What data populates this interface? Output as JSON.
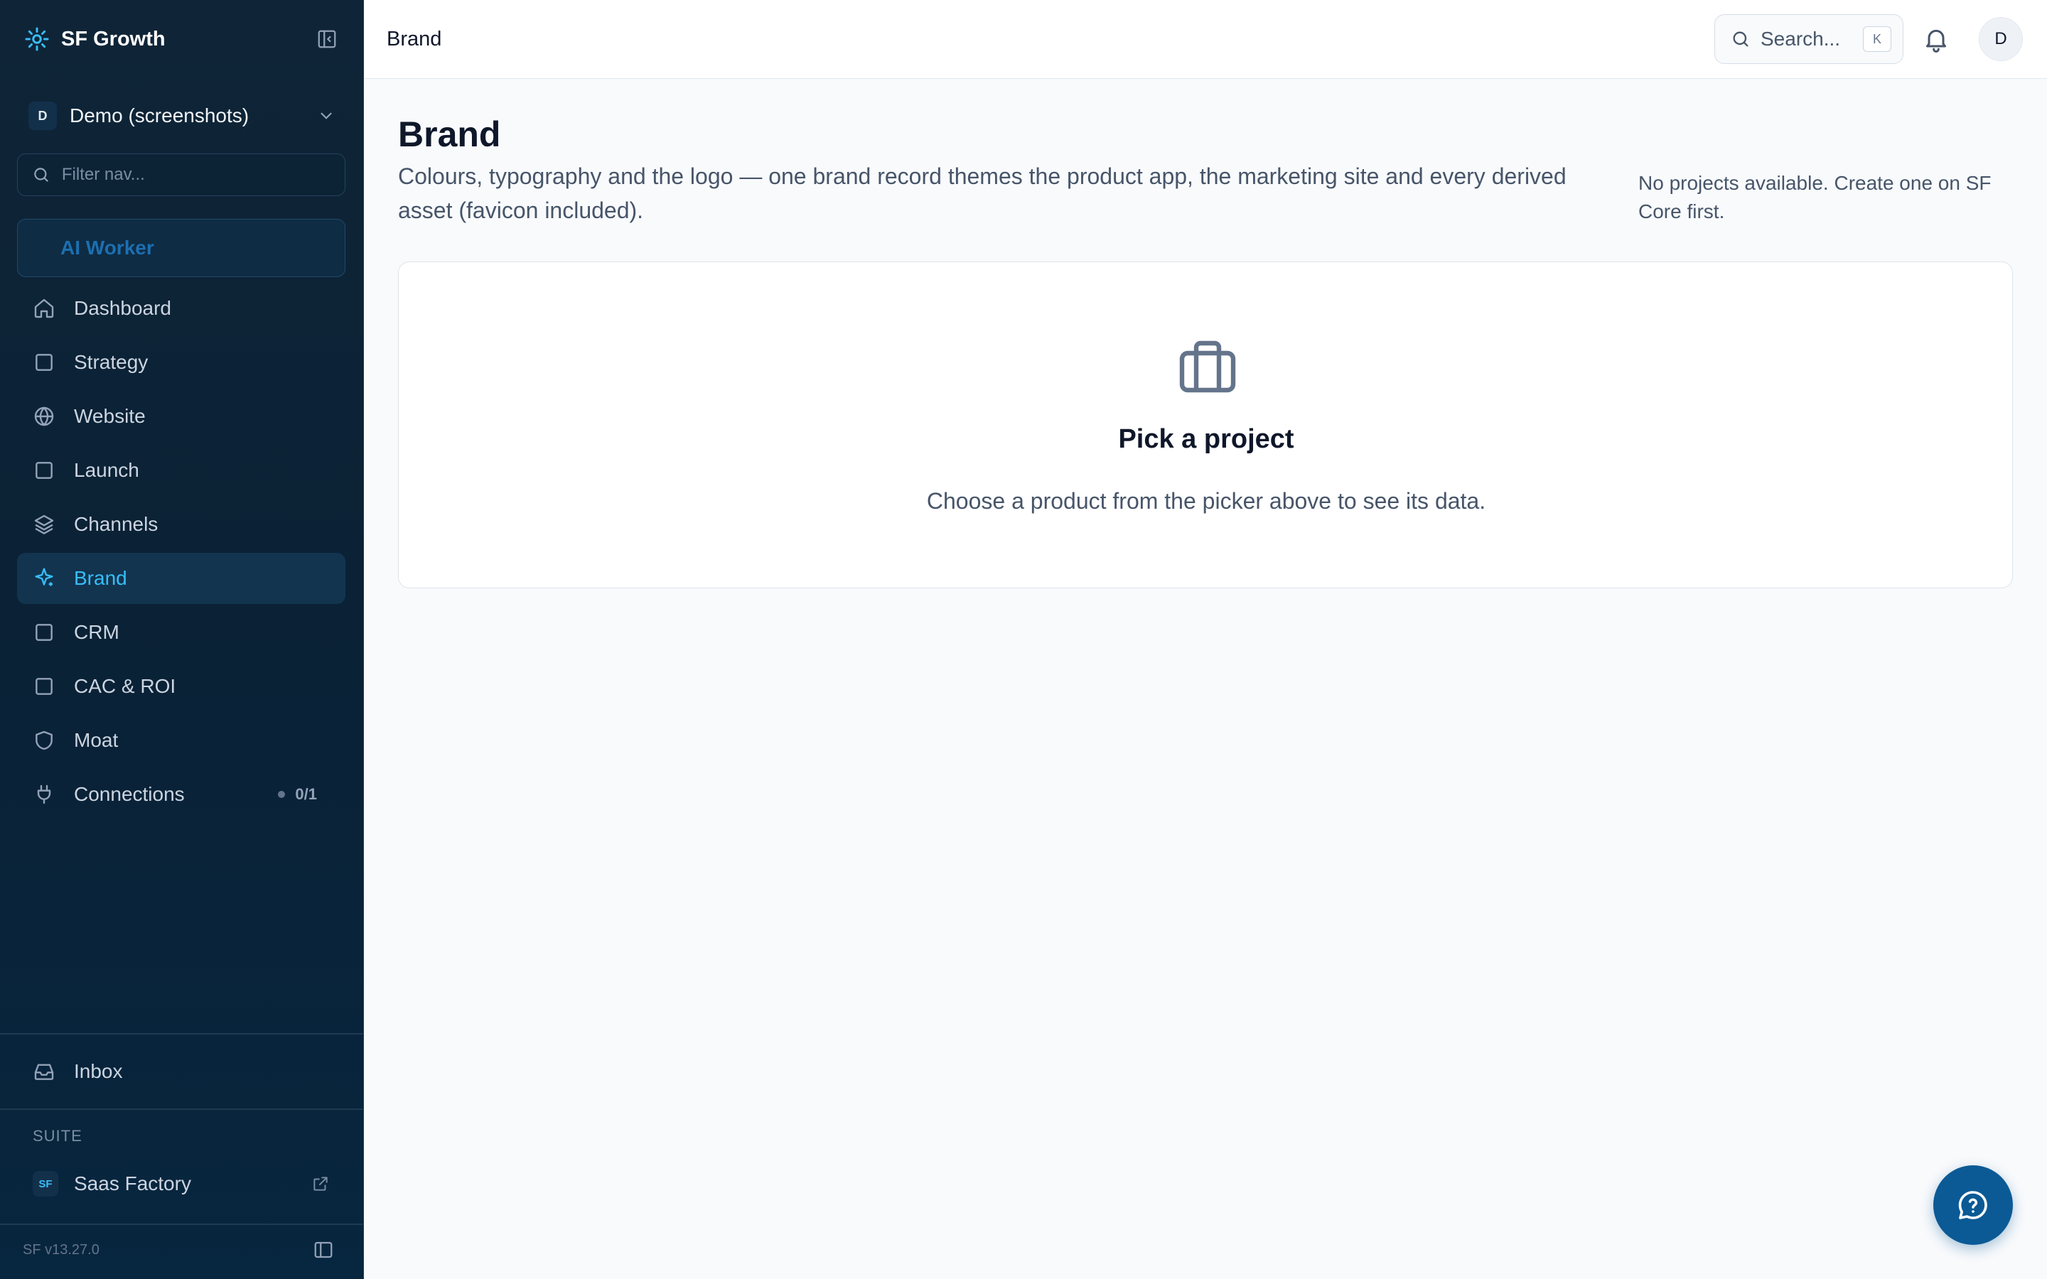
{
  "sidebar": {
    "app_name": "SF Growth",
    "workspace": {
      "initial": "D",
      "name": "Demo (screenshots)"
    },
    "filter_placeholder": "Filter nav...",
    "ai_worker_label": "AI Worker",
    "items": [
      {
        "label": "Dashboard",
        "icon": "home-icon"
      },
      {
        "label": "Strategy",
        "icon": "square-icon"
      },
      {
        "label": "Website",
        "icon": "globe-icon"
      },
      {
        "label": "Launch",
        "icon": "square-icon"
      },
      {
        "label": "Channels",
        "icon": "layers-icon"
      },
      {
        "label": "Brand",
        "icon": "sparkle-icon",
        "active": true
      },
      {
        "label": "CRM",
        "icon": "square-icon"
      },
      {
        "label": "CAC & ROI",
        "icon": "square-icon"
      },
      {
        "label": "Moat",
        "icon": "shield-icon"
      },
      {
        "label": "Connections",
        "icon": "plug-icon",
        "badge": "0/1"
      }
    ],
    "inbox_label": "Inbox",
    "suite_label": "SUITE",
    "suite_item": {
      "chip": "SF",
      "label": "Saas Factory"
    },
    "version": "SF v13.27.0"
  },
  "header": {
    "title": "Brand",
    "search_placeholder": "Search...",
    "search_shortcut": "K",
    "user_initial": "D"
  },
  "main": {
    "title": "Brand",
    "description": "Colours, typography and the logo — one brand record themes the product app, the marketing site and every derived asset (favicon included).",
    "side_note": "No projects available. Create one on SF Core first.",
    "empty_state": {
      "title": "Pick a project",
      "subtitle": "Choose a product from the picker above to see its data."
    }
  },
  "colors": {
    "sidebar_bg": "#0b2135",
    "accent": "#38bdf8",
    "fab": "#0b5a95"
  }
}
